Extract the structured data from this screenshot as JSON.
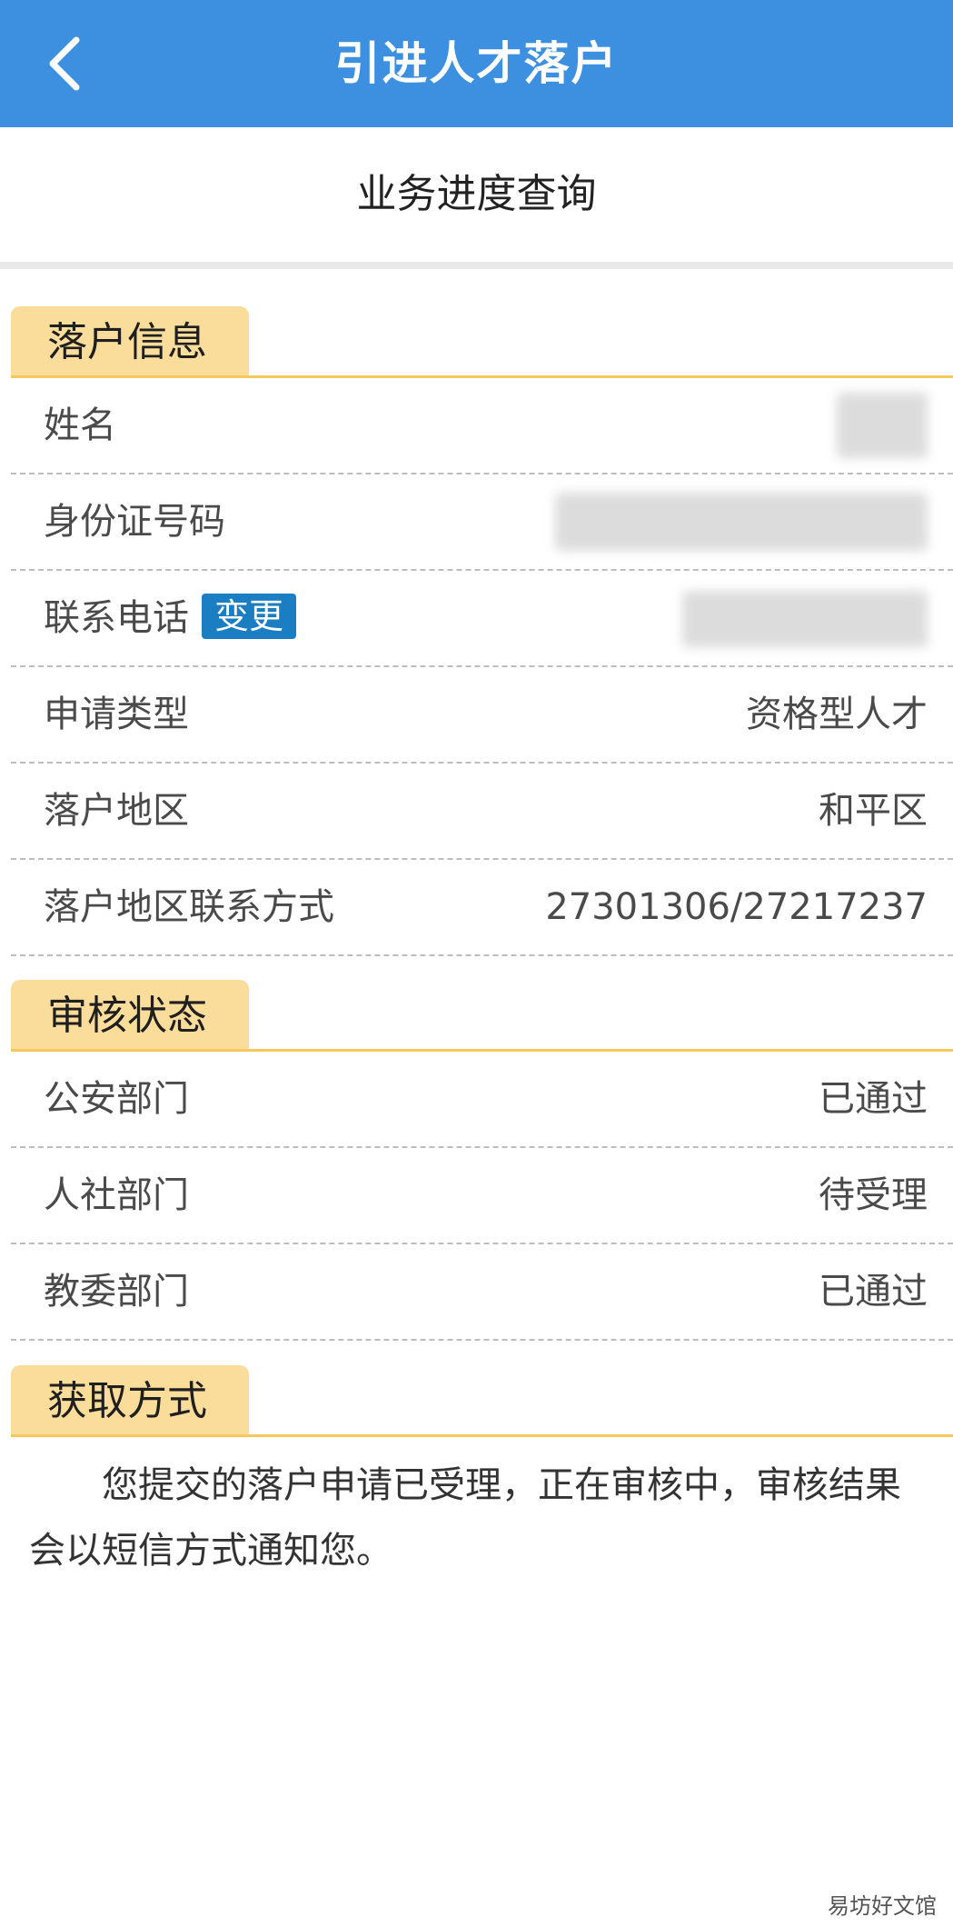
{
  "header": {
    "title": "引进人才落户",
    "back_icon": "chevron-left-icon",
    "color": "#3d90df"
  },
  "subheader": {
    "title": "业务进度查询"
  },
  "sections": {
    "settle_info": {
      "title": "落户信息",
      "rows": [
        {
          "label": "姓名",
          "value": ""
        },
        {
          "label": "身份证号码",
          "value": ""
        },
        {
          "label": "联系电话",
          "value": "",
          "action": "变更"
        },
        {
          "label": "申请类型",
          "value": "资格型人才"
        },
        {
          "label": "落户地区",
          "value": "和平区"
        },
        {
          "label": "落户地区联系方式",
          "value": "27301306/27217237"
        }
      ]
    },
    "review_status": {
      "title": "审核状态",
      "rows": [
        {
          "label": "公安部门",
          "value": "已通过"
        },
        {
          "label": "人社部门",
          "value": "待受理"
        },
        {
          "label": "教委部门",
          "value": "已通过"
        }
      ]
    },
    "retrieval": {
      "title": "获取方式",
      "text": "您提交的落户申请已受理，正在审核中，审核结果会以短信方式通知您。"
    }
  },
  "colors": {
    "tab_bg": "#fbdd9b",
    "tab_line": "#f5c85e",
    "badge": "#1b7dc2"
  },
  "watermark": "易坊好文馆"
}
